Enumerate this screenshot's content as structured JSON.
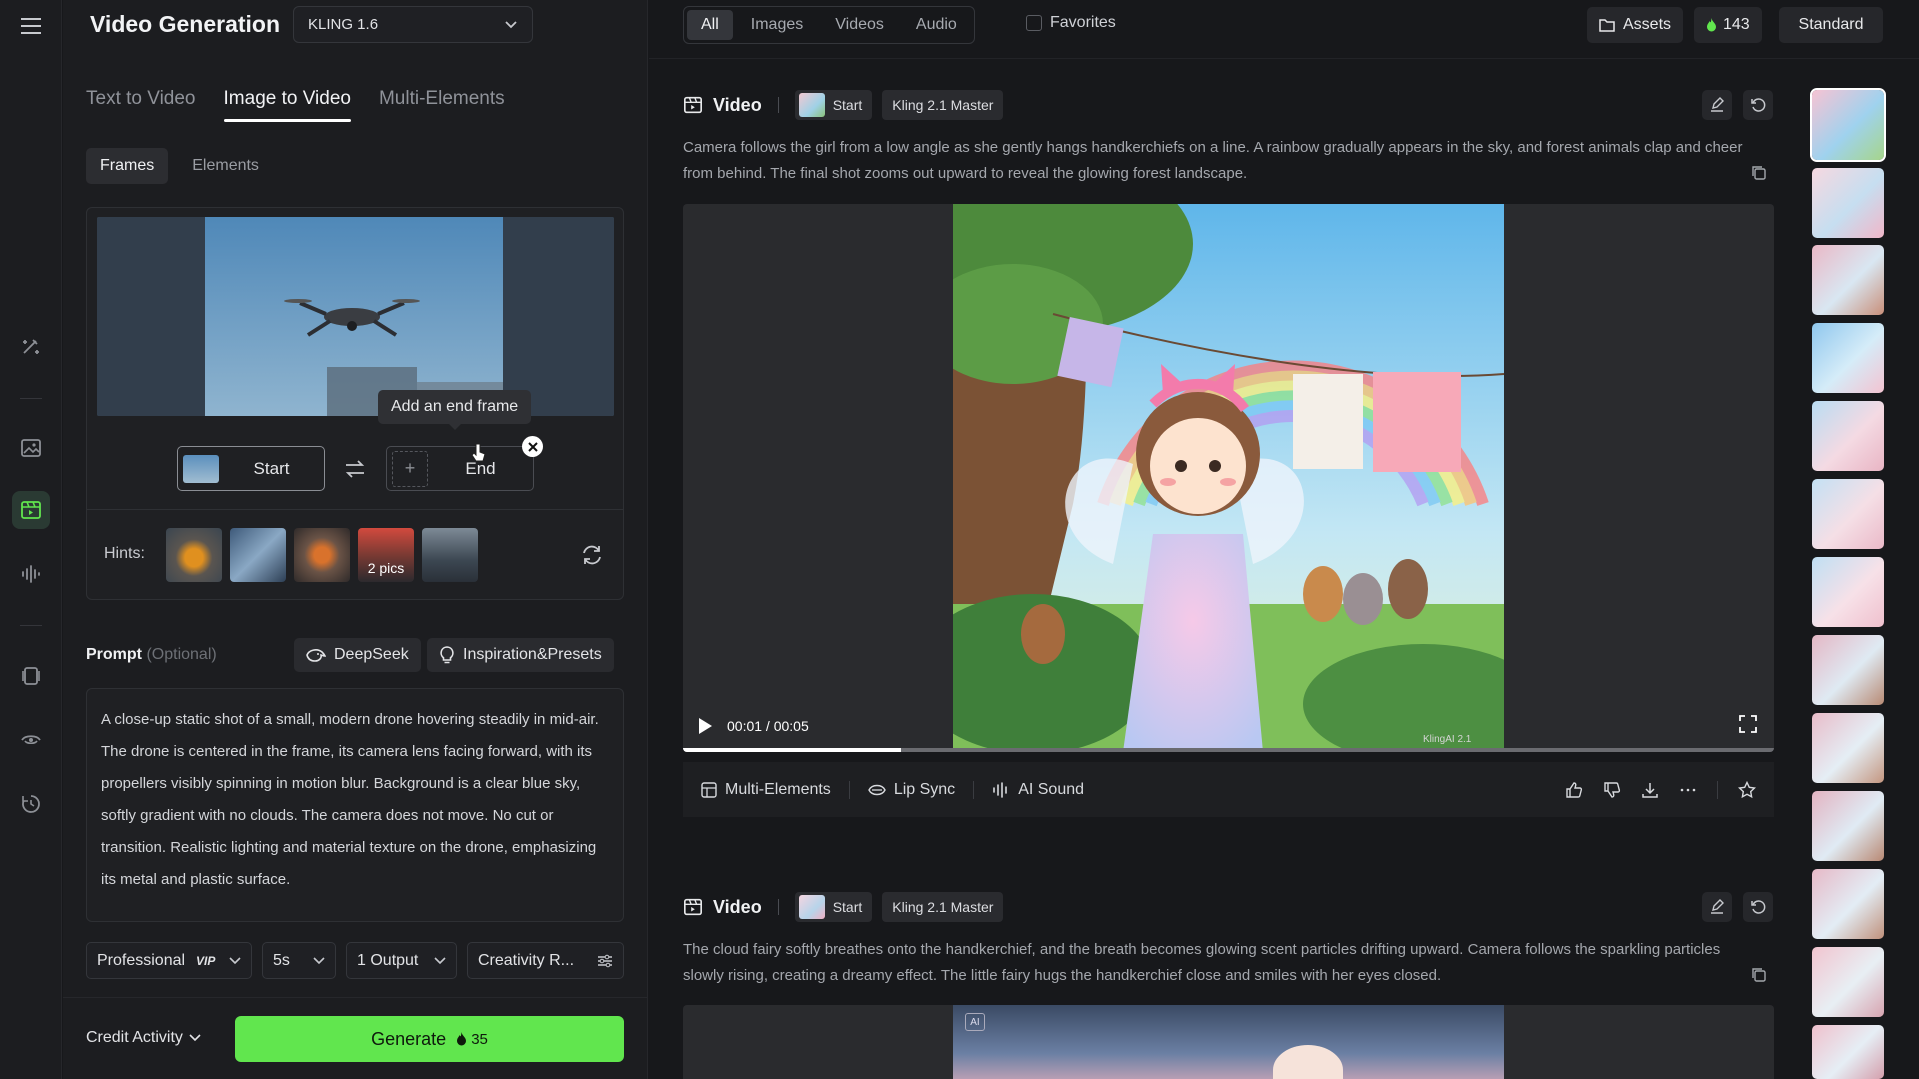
{
  "app": {
    "title": "Video Generation",
    "model": "KLING 1.6"
  },
  "tabs": [
    "Text to Video",
    "Image to Video",
    "Multi-Elements"
  ],
  "subtabs": [
    "Frames",
    "Elements"
  ],
  "frames": {
    "tooltip": "Add an end frame",
    "start_label": "Start",
    "end_label": "End",
    "hints_label": "Hints:",
    "hint_badge": "2 pics"
  },
  "prompt": {
    "label": "Prompt",
    "optional": "(Optional)",
    "deepseek": "DeepSeek",
    "inspiration": "Inspiration&Presets",
    "text": "A close-up static shot of a small, modern drone hovering steadily in mid-air. The drone is centered in the frame, its camera lens facing forward, with its propellers visibly spinning in motion blur. Background is a clear blue sky, softly gradient with no clouds. The camera does not move. No cut or transition. Realistic lighting and material texture on the drone, emphasizing its metal and plastic surface."
  },
  "settings": {
    "mode": "Professional",
    "mode_tag": "VIP",
    "duration": "5s",
    "outputs": "1 Output",
    "creativity": "Creativity R..."
  },
  "footer": {
    "credit_activity": "Credit Activity",
    "generate": "Generate",
    "generate_cost": "35"
  },
  "topbar": {
    "filters": [
      "All",
      "Images",
      "Videos",
      "Audio"
    ],
    "favorites": "Favorites",
    "assets": "Assets",
    "credits": "143",
    "plan": "Standard"
  },
  "cards": [
    {
      "type": "Video",
      "start": "Start",
      "model": "Kling 2.1 Master",
      "description": "Camera follows the girl from a low angle as she gently hangs handkerchiefs on a line. A rainbow gradually appears in the sky, and forest animals clap and cheer from behind. The final shot zooms out upward to reveal the glowing forest landscape.",
      "time": "00:01 / 00:05",
      "progress": 0.2,
      "watermark": "KlingAI 2.1",
      "actions": [
        "Multi-Elements",
        "Lip Sync",
        "AI Sound"
      ]
    },
    {
      "type": "Video",
      "start": "Start",
      "model": "Kling 2.1 Master",
      "description": "The cloud fairy softly breathes onto the handkerchief, and the breath becomes glowing scent particles drifting upward. Camera follows the sparkling particles slowly rising, creating a dreamy effect. The little fairy hugs the handkerchief close and smiles with her eyes closed.",
      "ai_tag": "AI"
    }
  ],
  "colors": {
    "accent_green": "#61e64e",
    "background": "#17181b"
  }
}
